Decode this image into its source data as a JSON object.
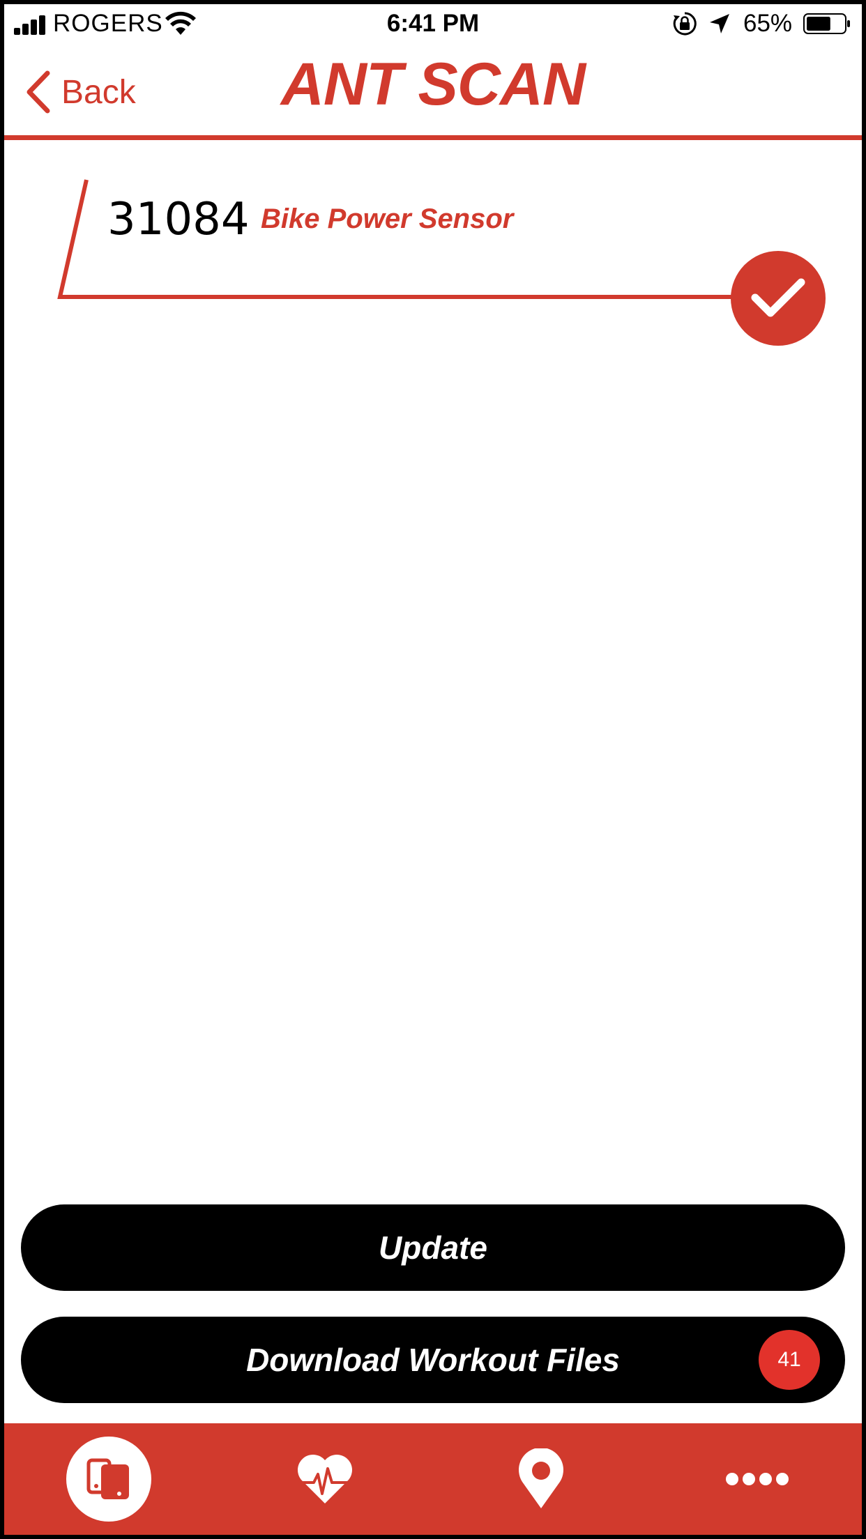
{
  "status_bar": {
    "carrier": "ROGERS",
    "time": "6:41 PM",
    "battery_percent": "65%",
    "battery_level": 0.65
  },
  "nav": {
    "back_label": "Back",
    "title": "ANT SCAN"
  },
  "devices": [
    {
      "id": "31084",
      "type": "Bike Power Sensor",
      "selected": true
    }
  ],
  "actions": {
    "update_label": "Update",
    "download_label": "Download Workout Files",
    "download_badge": "41"
  },
  "tab_bar": {
    "tabs": [
      {
        "icon": "devices-icon",
        "active": true
      },
      {
        "icon": "heart-rate-icon",
        "active": false
      },
      {
        "icon": "map-pin-icon",
        "active": false
      },
      {
        "icon": "more-dots-icon",
        "active": false
      }
    ]
  },
  "colors": {
    "accent": "#d13a2d",
    "badge": "#e2322b",
    "button": "#000000"
  }
}
